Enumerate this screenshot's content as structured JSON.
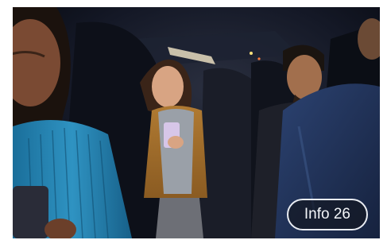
{
  "badge": {
    "label": "Info 26"
  }
}
